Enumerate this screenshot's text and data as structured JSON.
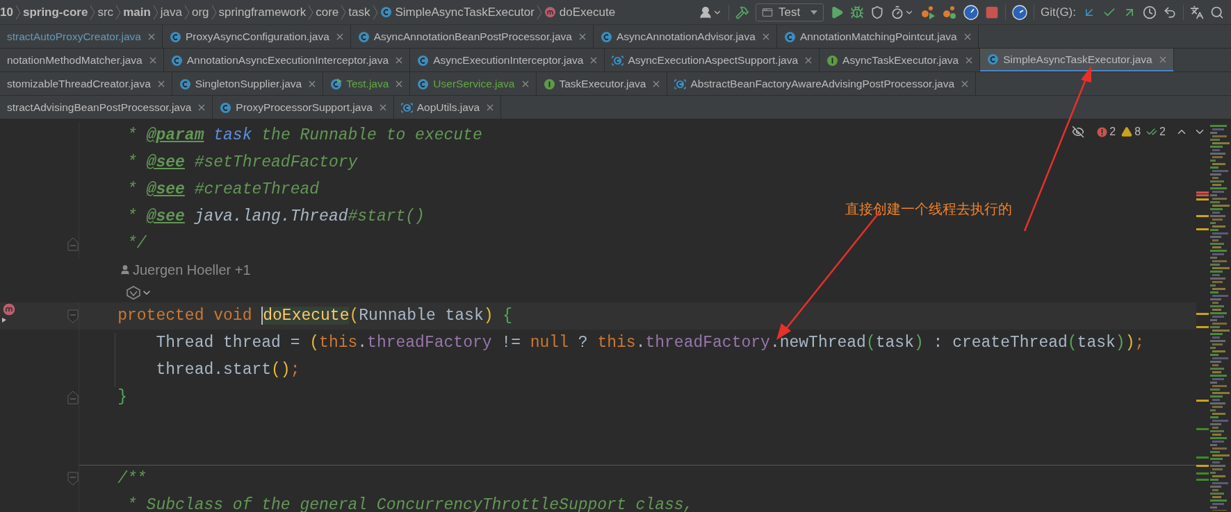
{
  "breadcrumbs": [
    {
      "text": "10",
      "kind": "bold"
    },
    {
      "text": "spring-core",
      "kind": "bold"
    },
    {
      "text": "src",
      "kind": "plain"
    },
    {
      "text": "main",
      "kind": "bold"
    },
    {
      "text": "java",
      "kind": "plain"
    },
    {
      "text": "org",
      "kind": "plain"
    },
    {
      "text": "springframework",
      "kind": "plain"
    },
    {
      "text": "core",
      "kind": "plain"
    },
    {
      "text": "task",
      "kind": "plain"
    },
    {
      "text": "SimpleAsyncTaskExecutor",
      "kind": "class"
    },
    {
      "text": "doExecute",
      "kind": "method"
    }
  ],
  "toolbar": {
    "run_config": "Test",
    "vcs_label": "Git(G):"
  },
  "tab_rows": [
    [
      {
        "name": "stractAutoProxyCreator.java",
        "kind": "cut",
        "color": "#6897bb",
        "selected": false
      },
      {
        "name": "ProxyAsyncConfiguration.java",
        "kind": "class",
        "color": "#bbbbbb",
        "selected": false
      },
      {
        "name": "AsyncAnnotationBeanPostProcessor.java",
        "kind": "class",
        "color": "#bbbbbb",
        "selected": false
      },
      {
        "name": "AsyncAnnotationAdvisor.java",
        "kind": "class",
        "color": "#bbbbbb",
        "selected": false
      },
      {
        "name": "AnnotationMatchingPointcut.java",
        "kind": "class",
        "color": "#bbbbbb",
        "selected": false
      }
    ],
    [
      {
        "name": "notationMethodMatcher.java",
        "kind": "cut",
        "color": "#bbbbbb",
        "selected": false
      },
      {
        "name": "AnnotationAsyncExecutionInterceptor.java",
        "kind": "class",
        "color": "#bbbbbb",
        "selected": false
      },
      {
        "name": "AsyncExecutionInterceptor.java",
        "kind": "class",
        "color": "#bbbbbb",
        "selected": false
      },
      {
        "name": "AsyncExecutionAspectSupport.java",
        "kind": "abstract",
        "color": "#bbbbbb",
        "selected": false
      },
      {
        "name": "AsyncTaskExecutor.java",
        "kind": "interface",
        "color": "#bbbbbb",
        "selected": false
      },
      {
        "name": "SimpleAsyncTaskExecutor.java",
        "kind": "class",
        "color": "#bbbbbb",
        "selected": true
      }
    ],
    [
      {
        "name": "stomizableThreadCreator.java",
        "kind": "cut",
        "color": "#bbbbbb",
        "selected": false
      },
      {
        "name": "SingletonSupplier.java",
        "kind": "class",
        "color": "#bbbbbb",
        "selected": false
      },
      {
        "name": "Test.java",
        "kind": "runnable",
        "color": "#62a846",
        "selected": false
      },
      {
        "name": "UserService.java",
        "kind": "class",
        "color": "#62a846",
        "selected": false
      },
      {
        "name": "TaskExecutor.java",
        "kind": "interface",
        "color": "#bbbbbb",
        "selected": false
      },
      {
        "name": "AbstractBeanFactoryAwareAdvisingPostProcessor.java",
        "kind": "abstract",
        "color": "#bbbbbb",
        "selected": false
      }
    ],
    [
      {
        "name": "stractAdvisingBeanPostProcessor.java",
        "kind": "cut",
        "color": "#bbbbbb",
        "selected": false
      },
      {
        "name": "ProxyProcessorSupport.java",
        "kind": "class",
        "color": "#bbbbbb",
        "selected": false
      },
      {
        "name": "AopUtils.java",
        "kind": "abstract",
        "color": "#bbbbbb",
        "selected": false
      }
    ]
  ],
  "inspections": {
    "errors": "2",
    "warnings": "8",
    "weak_warnings": "2"
  },
  "code_lines": [
    {
      "kind": "code",
      "fold_start": false,
      "fold_end": false,
      "override": false,
      "current": false,
      "separator": false,
      "tokens": [
        {
          "kind": "doc",
          "text": "     * "
        },
        {
          "kind": "doctag",
          "text": "@param"
        },
        {
          "kind": "docparam",
          "text": " task"
        },
        {
          "kind": "doc",
          "text": " the Runnable to execute"
        }
      ]
    },
    {
      "kind": "code",
      "fold_start": false,
      "fold_end": false,
      "override": false,
      "current": false,
      "separator": false,
      "tokens": [
        {
          "kind": "doc",
          "text": "     * "
        },
        {
          "kind": "doctag",
          "text": "@see"
        },
        {
          "kind": "doc",
          "text": " #setThreadFactory"
        }
      ]
    },
    {
      "kind": "code",
      "fold_start": false,
      "fold_end": false,
      "override": false,
      "current": false,
      "separator": false,
      "tokens": [
        {
          "kind": "doc",
          "text": "     * "
        },
        {
          "kind": "doctag",
          "text": "@see"
        },
        {
          "kind": "doc",
          "text": " #createThread"
        }
      ]
    },
    {
      "kind": "code",
      "fold_start": false,
      "fold_end": false,
      "override": false,
      "current": false,
      "separator": false,
      "tokens": [
        {
          "kind": "doc",
          "text": "     * "
        },
        {
          "kind": "doctag",
          "text": "@see"
        },
        {
          "kind": "docref",
          "text": " java.lang.Thread"
        },
        {
          "kind": "doc",
          "text": "#start()"
        }
      ]
    },
    {
      "kind": "code",
      "fold_start": false,
      "fold_end": true,
      "override": false,
      "current": false,
      "separator": false,
      "tokens": [
        {
          "kind": "doc",
          "text": "     */"
        }
      ]
    },
    {
      "kind": "author",
      "text": "Juergen Hoeller +1"
    },
    {
      "kind": "hint"
    },
    {
      "kind": "code",
      "fold_start": true,
      "fold_end": false,
      "override": true,
      "current": true,
      "separator": false,
      "tokens": [
        {
          "kind": "kw",
          "text": "    protected void "
        },
        {
          "kind": "fn_usage",
          "text": "doExecute"
        },
        {
          "kind": "b1",
          "text": "("
        },
        {
          "kind": "text",
          "text": "Runnable task"
        },
        {
          "kind": "b1",
          "text": ")"
        },
        {
          "kind": "b2",
          "text": " {"
        }
      ]
    },
    {
      "kind": "code",
      "fold_start": false,
      "fold_end": false,
      "override": false,
      "current": false,
      "separator": false,
      "tokens": [
        {
          "kind": "text",
          "text": "        Thread thread = "
        },
        {
          "kind": "b1",
          "text": "("
        },
        {
          "kind": "kw",
          "text": "this"
        },
        {
          "kind": "text",
          "text": "."
        },
        {
          "kind": "field",
          "text": "threadFactory"
        },
        {
          "kind": "text",
          "text": " != "
        },
        {
          "kind": "kw",
          "text": "null"
        },
        {
          "kind": "text",
          "text": " ? "
        },
        {
          "kind": "kw",
          "text": "this"
        },
        {
          "kind": "text",
          "text": "."
        },
        {
          "kind": "field",
          "text": "threadFactory"
        },
        {
          "kind": "text",
          "text": ".newThread"
        },
        {
          "kind": "b2",
          "text": "("
        },
        {
          "kind": "text",
          "text": "task"
        },
        {
          "kind": "b2",
          "text": ")"
        },
        {
          "kind": "text",
          "text": " : createThread"
        },
        {
          "kind": "b2",
          "text": "("
        },
        {
          "kind": "text",
          "text": "task"
        },
        {
          "kind": "b2",
          "text": ")"
        },
        {
          "kind": "b1",
          "text": ")"
        },
        {
          "kind": "punct",
          "text": ";"
        }
      ]
    },
    {
      "kind": "code",
      "fold_start": false,
      "fold_end": false,
      "override": false,
      "current": false,
      "separator": false,
      "tokens": [
        {
          "kind": "text",
          "text": "        thread.start"
        },
        {
          "kind": "b1",
          "text": "()"
        },
        {
          "kind": "punct",
          "text": ";"
        }
      ]
    },
    {
      "kind": "code",
      "fold_start": false,
      "fold_end": true,
      "override": false,
      "current": false,
      "separator": false,
      "tokens": [
        {
          "kind": "b2",
          "text": "    }"
        }
      ]
    },
    {
      "kind": "code",
      "fold_start": false,
      "fold_end": false,
      "override": false,
      "current": false,
      "separator": false
    },
    {
      "kind": "code",
      "fold_start": false,
      "fold_end": false,
      "override": false,
      "current": false,
      "separator": false
    },
    {
      "kind": "code",
      "fold_start": true,
      "fold_end": false,
      "override": false,
      "current": false,
      "separator": true,
      "tokens": [
        {
          "kind": "doc",
          "text": "    /**"
        }
      ]
    },
    {
      "kind": "code",
      "fold_start": false,
      "fold_end": false,
      "override": false,
      "current": false,
      "separator": false,
      "tokens": [
        {
          "kind": "doc",
          "text": "     * Subclass of the general ConcurrencyThrottleSupport class,"
        }
      ]
    }
  ],
  "annotation": {
    "text": "直接创建一个线程去执行的"
  }
}
